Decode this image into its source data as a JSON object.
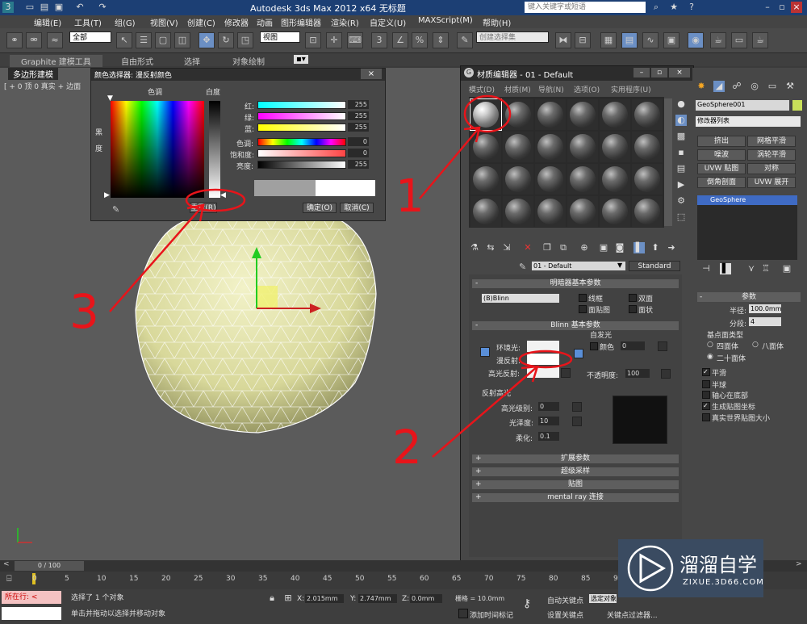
{
  "app": {
    "title": "Autodesk 3ds Max  2012 x64     无标题",
    "search_placeholder": "键入关键字或短语"
  },
  "menu": [
    "编辑(E)",
    "工具(T)",
    "组(G)",
    "视图(V)",
    "创建(C)",
    "修改器",
    "动画",
    "图形编辑器",
    "渲染(R)",
    "自定义(U)",
    "MAXScript(M)",
    "帮助(H)"
  ],
  "toolbar": {
    "selection_filter": "全部",
    "reference_coord": "视图",
    "named_selection": "创建选择集"
  },
  "ribbon": {
    "tabs": [
      "Graphite 建模工具",
      "自由形式",
      "选择",
      "对象绘制"
    ],
    "sub_label": "多边形建模"
  },
  "viewport": {
    "label": "[ + 0 顶 0 真实 + 边面",
    "axis_label": "x"
  },
  "color_selector": {
    "title": "颜色选择器: 漫反射颜色",
    "hue_label": "色调",
    "whiteness_label": "白度",
    "blackness_label": "黑度",
    "rows": [
      {
        "label": "红:",
        "value": "255"
      },
      {
        "label": "绿:",
        "value": "255"
      },
      {
        "label": "蓝:",
        "value": "255"
      },
      {
        "label": "色调:",
        "value": "0"
      },
      {
        "label": "饱和度:",
        "value": "0"
      },
      {
        "label": "亮度:",
        "value": "255"
      }
    ],
    "reset_label": "重置(R)",
    "ok_label": "确定(O)",
    "cancel_label": "取消(C)"
  },
  "material_editor": {
    "title": "材质编辑器 - 01 - Default",
    "menu": [
      "模式(D)",
      "材质(M)",
      "导航(N)",
      "选项(O)",
      "实用程序(U)"
    ],
    "material_name": "01 - Default",
    "material_type": "Standard",
    "shader_rollout": "明暗器基本参数",
    "shader": "(B)Blinn",
    "shader_options": [
      "线框",
      "双面",
      "面贴图",
      "面状"
    ],
    "blinn_rollout": "Blinn 基本参数",
    "self_illum": "自发光",
    "color_label": "颜色",
    "self_illum_value": "0",
    "ambient_label": "环境光:",
    "diffuse_label": "漫反射:",
    "specular_label": "高光反射:",
    "opacity_label": "不透明度:",
    "opacity_value": "100",
    "spec_highlights": "反射高光",
    "spec_level_label": "高光级别:",
    "spec_level_value": "0",
    "glossiness_label": "光泽度:",
    "glossiness_value": "10",
    "soften_label": "柔化:",
    "soften_value": "0.1",
    "rollouts": [
      "扩展参数",
      "超级采样",
      "贴图",
      "mental ray 连接"
    ]
  },
  "command_panel": {
    "object_name": "GeoSphere001",
    "modifier_list": "修改器列表",
    "modifiers": [
      "挤出",
      "网格平滑",
      "噪波",
      "涡轮平滑",
      "UVW 贴图",
      "对称",
      "倒角剖面",
      "UVW 展开"
    ],
    "stack_item": "GeoSphere",
    "params_title": "参数",
    "radius_label": "半径:",
    "radius_value": "100.0mm",
    "segments_label": "分段:",
    "segments_value": "4",
    "base_type_label": "基点面类型",
    "base_types": [
      "四面体",
      "八面体",
      "二十面体"
    ],
    "checks": [
      {
        "label": "平滑",
        "checked": true
      },
      {
        "label": "半球",
        "checked": false
      },
      {
        "label": "轴心在底部",
        "checked": false
      },
      {
        "label": "生成贴图坐标",
        "checked": true
      },
      {
        "label": "真实世界贴图大小",
        "checked": false
      }
    ]
  },
  "timeline": {
    "frame_label": "0 / 100",
    "ticks": [
      "0",
      "5",
      "10",
      "15",
      "20",
      "25",
      "30",
      "35",
      "40",
      "45",
      "50",
      "55",
      "60",
      "65",
      "70",
      "75",
      "80",
      "85",
      "90"
    ]
  },
  "status": {
    "current": "所在行: <",
    "selection": "选择了 1 个对象",
    "prompt": "单击并拖动以选择并移动对象",
    "x_value": "2.015mm",
    "y_value": "2.747mm",
    "z_value": "0.0mm",
    "grid": "栅格 = 10.0mm",
    "auto_key": "自动关键点",
    "selected": "选定对象",
    "set_key": "设置关键点",
    "key_filters": "关键点过滤器...",
    "add_time_tag": "添加时间标记"
  },
  "watermark": {
    "brand": "溜溜自学",
    "url": "ZIXUE.3D66.COM"
  },
  "annotations": [
    "1",
    "2",
    "3"
  ]
}
